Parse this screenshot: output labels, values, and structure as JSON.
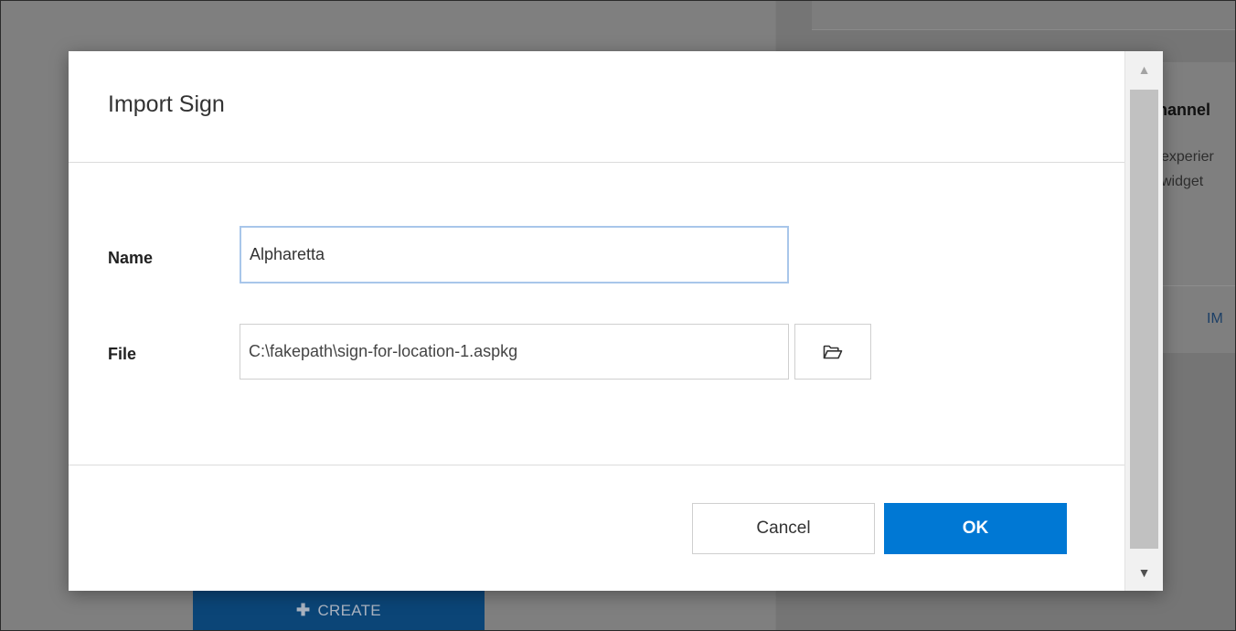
{
  "background": {
    "card_title": "hannel",
    "card_text_line1": "experier",
    "card_text_line2": "widget",
    "card_link": "IM",
    "create_button": {
      "icon": "plus-icon",
      "icon_glyph": "✚",
      "label": "CREATE"
    }
  },
  "dialog": {
    "title": "Import Sign",
    "name_label": "Name",
    "name_value": "Alpharetta",
    "file_label": "File",
    "file_value": "C:\\fakepath\\sign-for-location-1.aspkg",
    "browse_icon": "folder-open-icon",
    "browse_glyph": "🗁",
    "cancel_label": "Cancel",
    "ok_label": "OK"
  },
  "colors": {
    "primary": "#0078d4",
    "focus_border": "#a8c6ea",
    "overlay": "#7f7f7f"
  }
}
